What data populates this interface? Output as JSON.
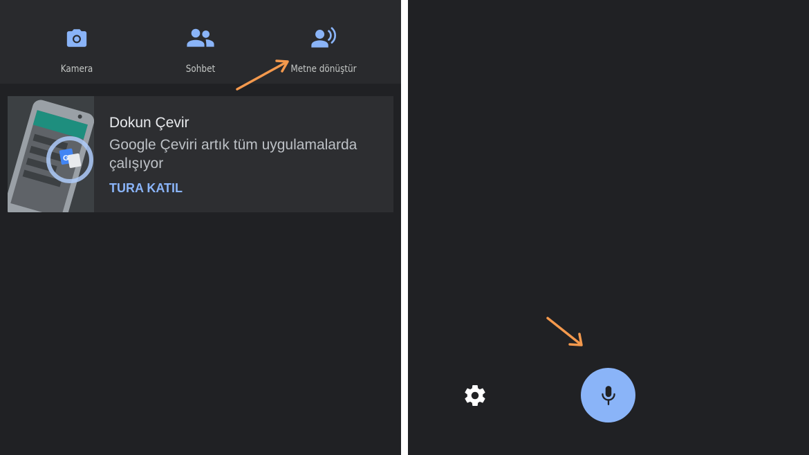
{
  "colors": {
    "background": "#202124",
    "topbar": "#292a2d",
    "card": "#2d2e31",
    "accent_blue": "#8ab4f8",
    "arrow_orange": "#f4994d",
    "text_primary": "#e8eaed",
    "text_secondary": "#bdc1c6"
  },
  "left_panel": {
    "nav": [
      {
        "label": "Kamera",
        "icon": "camera-icon"
      },
      {
        "label": "Sohbet",
        "icon": "people-icon"
      },
      {
        "label": "Metne dönüştür",
        "icon": "transcribe-icon"
      }
    ],
    "card": {
      "title": "Dokun Çevir",
      "description": "Google Çeviri artık tüm uygulamalarda çalışıyor",
      "cta": "TURA KATIL",
      "illustration_icon": "google-translate-icon"
    },
    "annotation_arrow": "arrow-pointing-to-transcribe"
  },
  "right_panel": {
    "settings_icon": "gear-icon",
    "mic_icon": "microphone-icon",
    "annotation_arrow": "arrow-pointing-to-microphone"
  }
}
